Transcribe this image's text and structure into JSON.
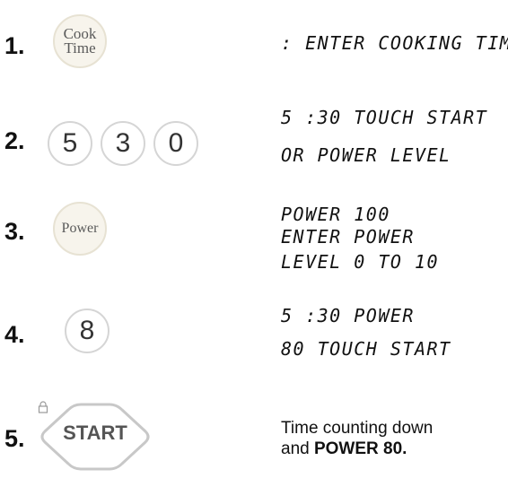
{
  "steps": [
    {
      "number": "1.",
      "button_label": "Cook\nTime",
      "display_lines": [
        ": ENTER COOKING TIME"
      ]
    },
    {
      "number": "2.",
      "digits": [
        "5",
        "3",
        "0"
      ],
      "display_lines": [
        "5 :30 TOUCH START",
        "OR POWER LEVEL"
      ]
    },
    {
      "number": "3.",
      "button_label": "Power",
      "display_lines": [
        "POWER 100",
        "ENTER POWER",
        "LEVEL 0 TO 10"
      ]
    },
    {
      "number": "4.",
      "digits": [
        "8"
      ],
      "display_lines": [
        "5 :30 POWER",
        "80 TOUCH START"
      ]
    },
    {
      "number": "5.",
      "button_label": "START",
      "button_icon": "lock-icon",
      "description_text": "Time counting down",
      "description_and": "and ",
      "description_bold": "POWER 80."
    }
  ]
}
